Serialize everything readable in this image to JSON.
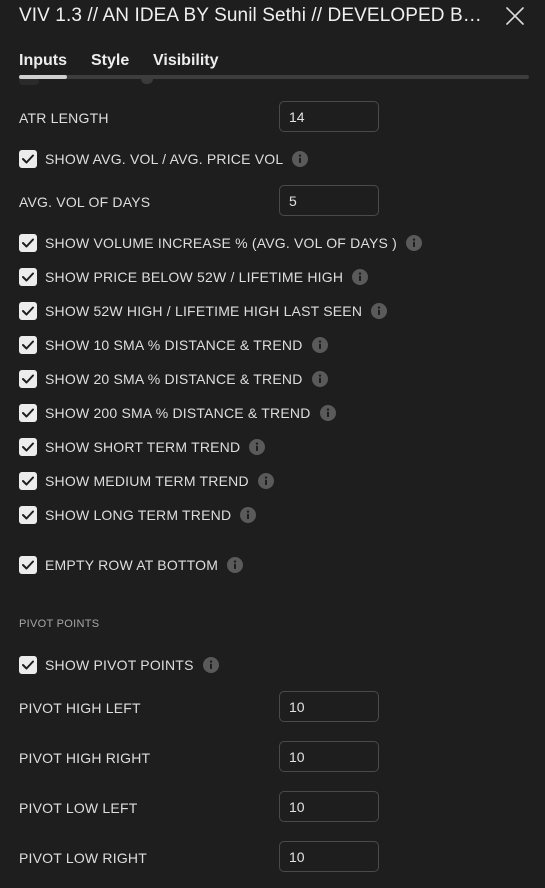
{
  "header": {
    "title": "VIV 1.3 // AN IDEA BY Sunil Sethi // DEVELOPED BY ...",
    "close_icon": "close-icon"
  },
  "tabs": [
    {
      "label": "Inputs",
      "active": true
    },
    {
      "label": "Style",
      "active": false
    },
    {
      "label": "Visibility",
      "active": false
    }
  ],
  "fields": {
    "atr_length": {
      "label": "ATR LENGTH",
      "value": "14"
    },
    "avg_vol_days": {
      "label": "AVG. VOL OF DAYS",
      "value": "5"
    },
    "pivot_high_left": {
      "label": "PIVOT HIGH LEFT",
      "value": "10"
    },
    "pivot_high_right": {
      "label": "PIVOT HIGH RIGHT",
      "value": "10"
    },
    "pivot_low_left": {
      "label": "PIVOT LOW LEFT",
      "value": "10"
    },
    "pivot_low_right": {
      "label": "PIVOT LOW RIGHT",
      "value": "10"
    }
  },
  "checkboxes": [
    {
      "label": "SHOW AVG. VOL / AVG. PRICE VOL",
      "checked": true
    },
    {
      "label": "SHOW VOLUME INCREASE % (AVG. VOL OF DAYS )",
      "checked": true
    },
    {
      "label": "SHOW PRICE BELOW 52W / LIFETIME HIGH",
      "checked": true
    },
    {
      "label": "SHOW 52W HIGH / LIFETIME HIGH LAST SEEN",
      "checked": true
    },
    {
      "label": "SHOW 10 SMA % DISTANCE & TREND",
      "checked": true
    },
    {
      "label": "SHOW 20 SMA % DISTANCE & TREND",
      "checked": true
    },
    {
      "label": "SHOW 200 SMA % DISTANCE & TREND",
      "checked": true
    },
    {
      "label": "SHOW SHORT TERM TREND",
      "checked": true
    },
    {
      "label": "SHOW MEDIUM TERM TREND",
      "checked": true
    },
    {
      "label": "SHOW LONG TERM TREND",
      "checked": true
    },
    {
      "label": "EMPTY ROW AT BOTTOM",
      "checked": true
    },
    {
      "label": "SHOW PIVOT POINTS",
      "checked": true
    }
  ],
  "sections": {
    "pivot_points": "PIVOT POINTS"
  },
  "colors": {
    "background": "#1e1e1e",
    "checkbox": "#ececec",
    "info_icon": "#5a5a5a"
  }
}
